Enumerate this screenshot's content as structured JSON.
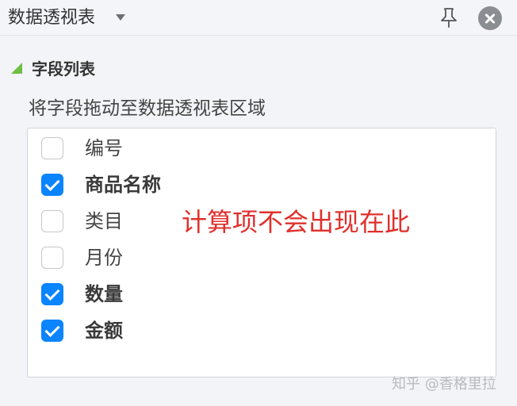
{
  "pane": {
    "title": "数据透视表",
    "caret_icon": "caret-down-icon",
    "pin_icon": "pin-icon",
    "close_icon": "close-circle-icon"
  },
  "field_section": {
    "title": "字段列表",
    "toggle_icon": "triangle-collapse-icon",
    "hint": "将字段拖动至数据透视表区域",
    "fields": [
      {
        "label": "编号",
        "checked": false
      },
      {
        "label": "商品名称",
        "checked": true
      },
      {
        "label": "类目",
        "checked": false
      },
      {
        "label": "月份",
        "checked": false
      },
      {
        "label": "数量",
        "checked": true
      },
      {
        "label": "金额",
        "checked": true
      }
    ]
  },
  "annotation": "计算项不会出现在此",
  "watermark": "知乎 @香格里拉",
  "colors": {
    "checkbox_checked": "#0a84ff",
    "annotation_text": "#e0302c",
    "toggle_triangle": "#6fbe44",
    "background": "#f2f4f7"
  }
}
